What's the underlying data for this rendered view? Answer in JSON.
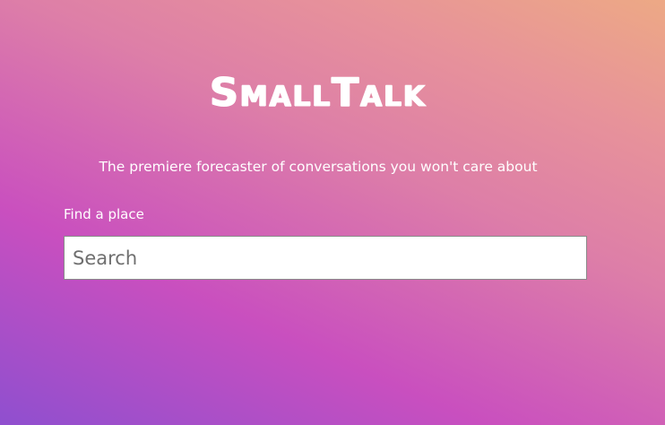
{
  "app": {
    "logo_text": "SmallTalk",
    "tagline": "The premiere forecaster of conversations you won't care about"
  },
  "search": {
    "label": "Find a place",
    "placeholder": "Search",
    "value": ""
  },
  "colors": {
    "gradient_start": "#8f4fcf",
    "gradient_mid": "#c94fbf",
    "gradient_end": "#eda985",
    "text": "#ffffff"
  }
}
